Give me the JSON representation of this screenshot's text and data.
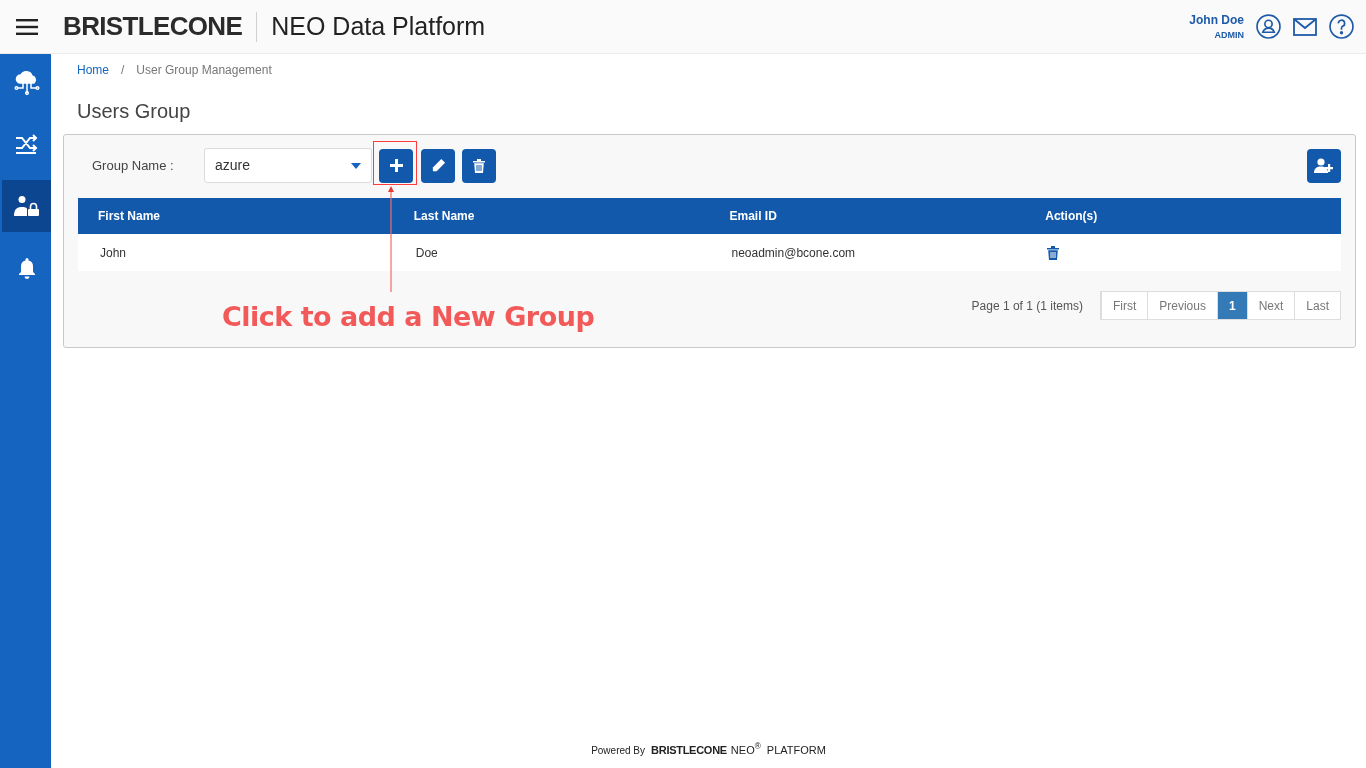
{
  "header": {
    "logo": "BRISTLECONE",
    "title": "NEO Data Platform",
    "user": {
      "name": "John Doe",
      "role": "ADMIN"
    }
  },
  "sidebar": {
    "items": [
      {
        "kind": "cloud",
        "selected": false
      },
      {
        "kind": "shuffle",
        "selected": false
      },
      {
        "kind": "users",
        "selected": true
      },
      {
        "kind": "bell",
        "selected": false
      }
    ]
  },
  "breadcrumb": [
    {
      "label": "Home",
      "link": true
    },
    {
      "label": "User Group Management",
      "link": false
    }
  ],
  "breadcrumb_separator": "/",
  "page_title": "Users Group",
  "group_filter": {
    "label": "Group Name :",
    "value": "azure"
  },
  "table": {
    "columns": [
      "First Name",
      "Last Name",
      "Email ID",
      "Action(s)"
    ],
    "rows": [
      {
        "first_name": "John",
        "last_name": "Doe",
        "email": "neoadmin@bcone.com"
      }
    ]
  },
  "pagination": {
    "summary": "Page 1 of 1 (1 items)",
    "buttons": [
      {
        "label": "First",
        "selected": false
      },
      {
        "label": "Previous",
        "selected": false
      },
      {
        "label": "1",
        "selected": true
      },
      {
        "label": "Next",
        "selected": false
      },
      {
        "label": "Last",
        "selected": false
      }
    ]
  },
  "annotation": {
    "text": "Click to add a New Group"
  },
  "footer": {
    "powered_by": "Powered By",
    "brand": "BRISTLECONE",
    "product": "NEO$^{®}$",
    "suffix": "PLATFORM"
  }
}
